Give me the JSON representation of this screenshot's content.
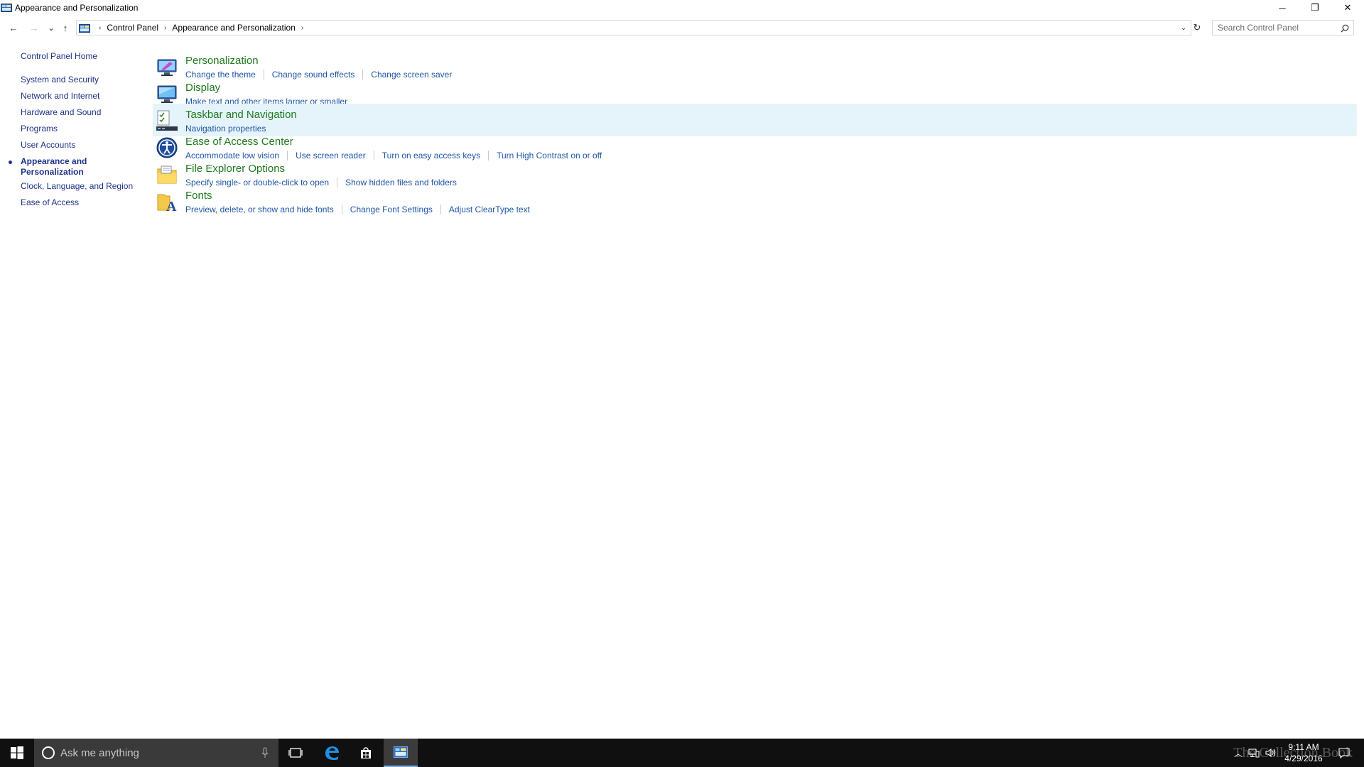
{
  "window": {
    "title": "Appearance and Personalization",
    "minimize_glyph": "─",
    "maximize_glyph": "❐",
    "close_glyph": "✕"
  },
  "nav": {
    "back_glyph": "←",
    "forward_glyph": "→",
    "recent_glyph": "⌄",
    "up_glyph": "↑",
    "breadcrumb": [
      "Control Panel",
      "Appearance and Personalization"
    ],
    "refresh_glyph": "↻",
    "search_placeholder": "Search Control Panel"
  },
  "sidebar": {
    "home": "Control Panel Home",
    "items": [
      {
        "label": "System and Security"
      },
      {
        "label": "Network and Internet"
      },
      {
        "label": "Hardware and Sound"
      },
      {
        "label": "Programs"
      },
      {
        "label": "User Accounts"
      },
      {
        "label": "Appearance and Personalization",
        "current": true
      },
      {
        "label": "Clock, Language, and Region"
      },
      {
        "label": "Ease of Access"
      }
    ],
    "current_line1": "Appearance and",
    "current_line2": "Personalization"
  },
  "categories": [
    {
      "title": "Personalization",
      "icon": "personalization-icon",
      "links": [
        "Change the theme",
        "Change sound effects",
        "Change screen saver"
      ]
    },
    {
      "title": "Display",
      "icon": "display-icon",
      "links": [
        "Make text and other items larger or smaller"
      ]
    },
    {
      "title": "Taskbar and Navigation",
      "icon": "taskbar-icon",
      "links": [
        "Navigation properties"
      ],
      "highlighted": true
    },
    {
      "title": "Ease of Access Center",
      "icon": "ease-of-access-icon",
      "links": [
        "Accommodate low vision",
        "Use screen reader",
        "Turn on easy access keys",
        "Turn High Contrast on or off"
      ]
    },
    {
      "title": "File Explorer Options",
      "icon": "folder-options-icon",
      "links": [
        "Specify single- or double-click to open",
        "Show hidden files and folders"
      ]
    },
    {
      "title": "Fonts",
      "icon": "fonts-icon",
      "links": [
        "Preview, delete, or show and hide fonts",
        "Change Font Settings",
        "Adjust ClearType text"
      ]
    }
  ],
  "taskbar": {
    "search_placeholder": "Ask me anything",
    "time": "9:11 AM",
    "date": "4/29/2016",
    "watermark": "The Collection Book"
  },
  "colors": {
    "link": "#1e55a5",
    "category_title": "#1e7a1e",
    "nav_link": "#1e3287",
    "hover_row": "#e5f3fb",
    "taskbar": "#101010"
  }
}
